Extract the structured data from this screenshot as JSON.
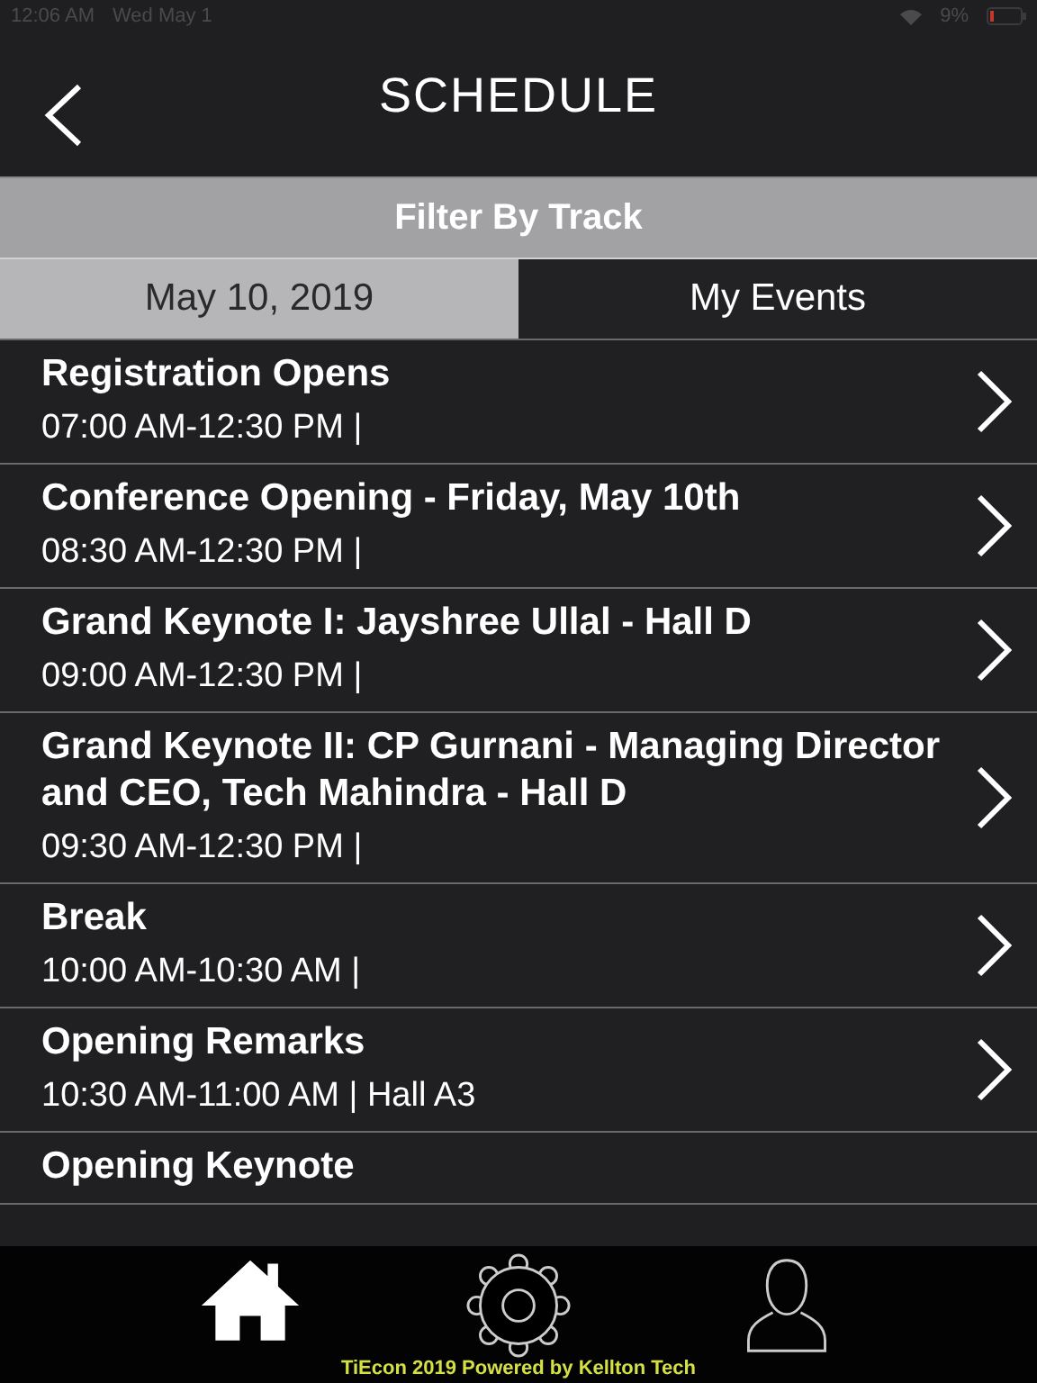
{
  "status_bar": {
    "time": "12:06 AM",
    "date": "Wed May 1",
    "battery": "9%"
  },
  "header": {
    "title": "SCHEDULE"
  },
  "filter": {
    "label": "Filter By Track"
  },
  "tabs": [
    {
      "label": "May 10, 2019",
      "selected": true
    },
    {
      "label": "My Events",
      "selected": false
    }
  ],
  "events": [
    {
      "title": "Registration Opens",
      "subtitle": "07:00 AM-12:30 PM |"
    },
    {
      "title": "Conference Opening - Friday, May 10th",
      "subtitle": "08:30 AM-12:30 PM |"
    },
    {
      "title": "Grand Keynote I: Jayshree Ullal - Hall D",
      "subtitle": "09:00 AM-12:30 PM |"
    },
    {
      "title": "Grand Keynote II: CP Gurnani - Managing Director and CEO, Tech Mahindra - Hall D",
      "subtitle": "09:30 AM-12:30 PM |"
    },
    {
      "title": "Break",
      "subtitle": "10:00 AM-10:30 AM |"
    },
    {
      "title": "Opening Remarks",
      "subtitle": "10:30 AM-11:00 AM | Hall A3"
    },
    {
      "title": "Opening Keynote"
    }
  ],
  "bottom_nav": [
    {
      "kind": "home",
      "selected": true
    },
    {
      "kind": "settings",
      "selected": false
    },
    {
      "kind": "profile",
      "selected": false
    }
  ],
  "footer": "TiEcon 2019 Powered by Kellton Tech"
}
